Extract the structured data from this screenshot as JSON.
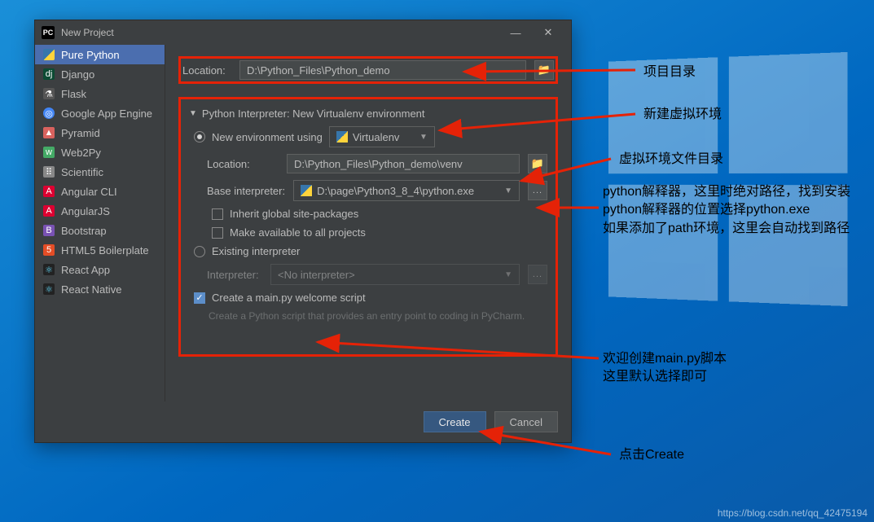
{
  "titlebar": {
    "title": "New Project"
  },
  "sidebar": {
    "items": [
      {
        "label": "Pure Python",
        "selected": true,
        "iconClass": "ic-py"
      },
      {
        "label": "Django",
        "iconClass": "ic-dj",
        "glyph": "dj"
      },
      {
        "label": "Flask",
        "iconClass": "ic-fl",
        "glyph": "⚗"
      },
      {
        "label": "Google App Engine",
        "iconClass": "ic-ga",
        "glyph": "◎"
      },
      {
        "label": "Pyramid",
        "iconClass": "ic-pr",
        "glyph": "▲"
      },
      {
        "label": "Web2Py",
        "iconClass": "ic-w2",
        "glyph": "w"
      },
      {
        "label": "Scientific",
        "iconClass": "ic-sc",
        "glyph": "⠿"
      },
      {
        "label": "Angular CLI",
        "iconClass": "ic-an",
        "glyph": "A"
      },
      {
        "label": "AngularJS",
        "iconClass": "ic-aj",
        "glyph": "A"
      },
      {
        "label": "Bootstrap",
        "iconClass": "ic-bs",
        "glyph": "B"
      },
      {
        "label": "HTML5 Boilerplate",
        "iconClass": "ic-h5",
        "glyph": "5"
      },
      {
        "label": "React App",
        "iconClass": "ic-rn",
        "glyph": "⚛"
      },
      {
        "label": "React Native",
        "iconClass": "ic-rn",
        "glyph": "⚛"
      }
    ]
  },
  "main": {
    "location_label": "Location:",
    "location_value": "D:\\Python_Files\\Python_demo",
    "interp_header": "Python Interpreter: New Virtualenv environment",
    "new_env_label": "New environment using",
    "venv_combo": "Virtualenv",
    "venv_location_label": "Location:",
    "venv_location_value": "D:\\Python_Files\\Python_demo\\venv",
    "base_interp_label": "Base interpreter:",
    "base_interp_value": "D:\\page\\Python3_8_4\\python.exe",
    "inherit_label": "Inherit global site-packages",
    "makeavail_label": "Make available to all projects",
    "existing_label": "Existing interpreter",
    "interp_sub_label": "Interpreter:",
    "no_interp": "<No interpreter>",
    "create_mainpy_label": "Create a main.py welcome script",
    "create_mainpy_hint": "Create a Python script that provides an entry point to coding in PyCharm."
  },
  "footer": {
    "create": "Create",
    "cancel": "Cancel"
  },
  "annotations": {
    "a1": "项目目录",
    "a2": "新建虚拟环境",
    "a3": "虚拟环境文件目录",
    "a4": "python解释器，这里时绝对路径，找到安装python解释器的位置选择python.exe\n如果添加了path环境，这里会自动找到路径",
    "a5": "欢迎创建main.py脚本\n这里默认选择即可",
    "a6": "点击Create"
  },
  "watermark": "https://blog.csdn.net/qq_42475194"
}
